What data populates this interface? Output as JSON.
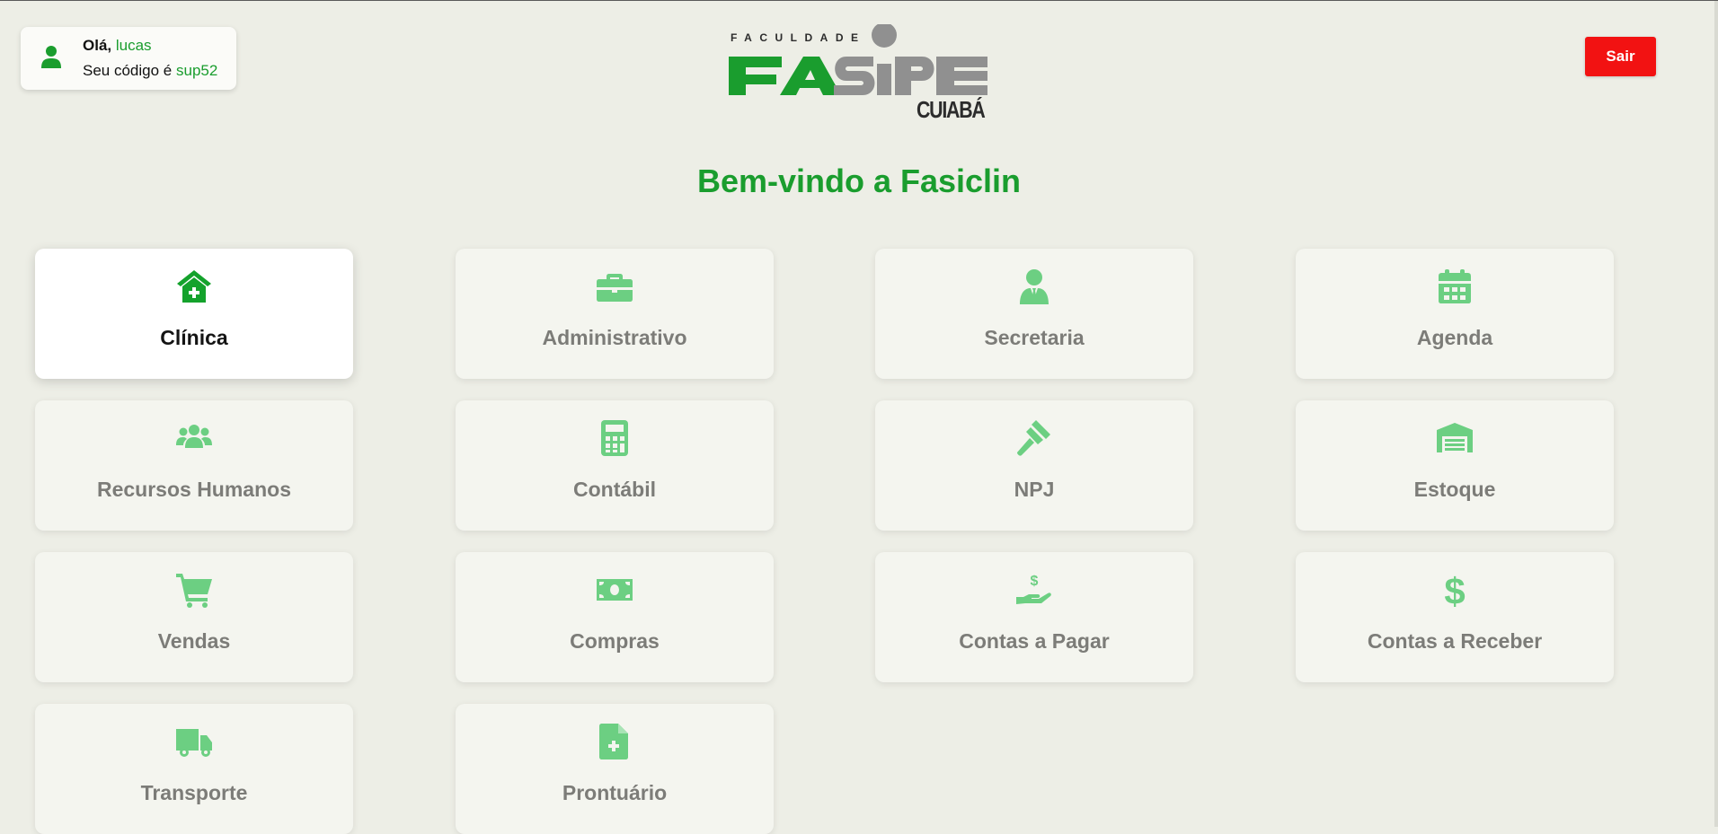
{
  "user": {
    "greeting_prefix": "Olá,",
    "name": "lucas",
    "code_prefix": "Seu código é",
    "code": "sup52"
  },
  "logo": {
    "top_text": "FACULDADE",
    "brand": "FASIPE",
    "city": "CUIABÁ"
  },
  "header": {
    "logout_label": "Sair"
  },
  "welcome_title": "Bem-vindo a Fasiclin",
  "tiles": [
    {
      "label": "Clínica",
      "icon": "clinic-icon",
      "active": true
    },
    {
      "label": "Administrativo",
      "icon": "briefcase-icon"
    },
    {
      "label": "Secretaria",
      "icon": "user-tie-icon"
    },
    {
      "label": "Agenda",
      "icon": "calendar-icon"
    },
    {
      "label": "Recursos Humanos",
      "icon": "users-icon"
    },
    {
      "label": "Contábil",
      "icon": "calculator-icon"
    },
    {
      "label": "NPJ",
      "icon": "gavel-icon"
    },
    {
      "label": "Estoque",
      "icon": "warehouse-icon"
    },
    {
      "label": "Vendas",
      "icon": "cart-icon"
    },
    {
      "label": "Compras",
      "icon": "money-bill-icon"
    },
    {
      "label": "Contas a Pagar",
      "icon": "hand-dollar-icon"
    },
    {
      "label": "Contas a Receber",
      "icon": "dollar-icon"
    },
    {
      "label": "Transporte",
      "icon": "truck-icon"
    },
    {
      "label": "Prontuário",
      "icon": "medical-file-icon"
    }
  ],
  "colors": {
    "accent_green": "#1a9d2e",
    "icon_green_light": "#6ccf82",
    "logout_red": "#f21212",
    "background": "#edeee6"
  }
}
